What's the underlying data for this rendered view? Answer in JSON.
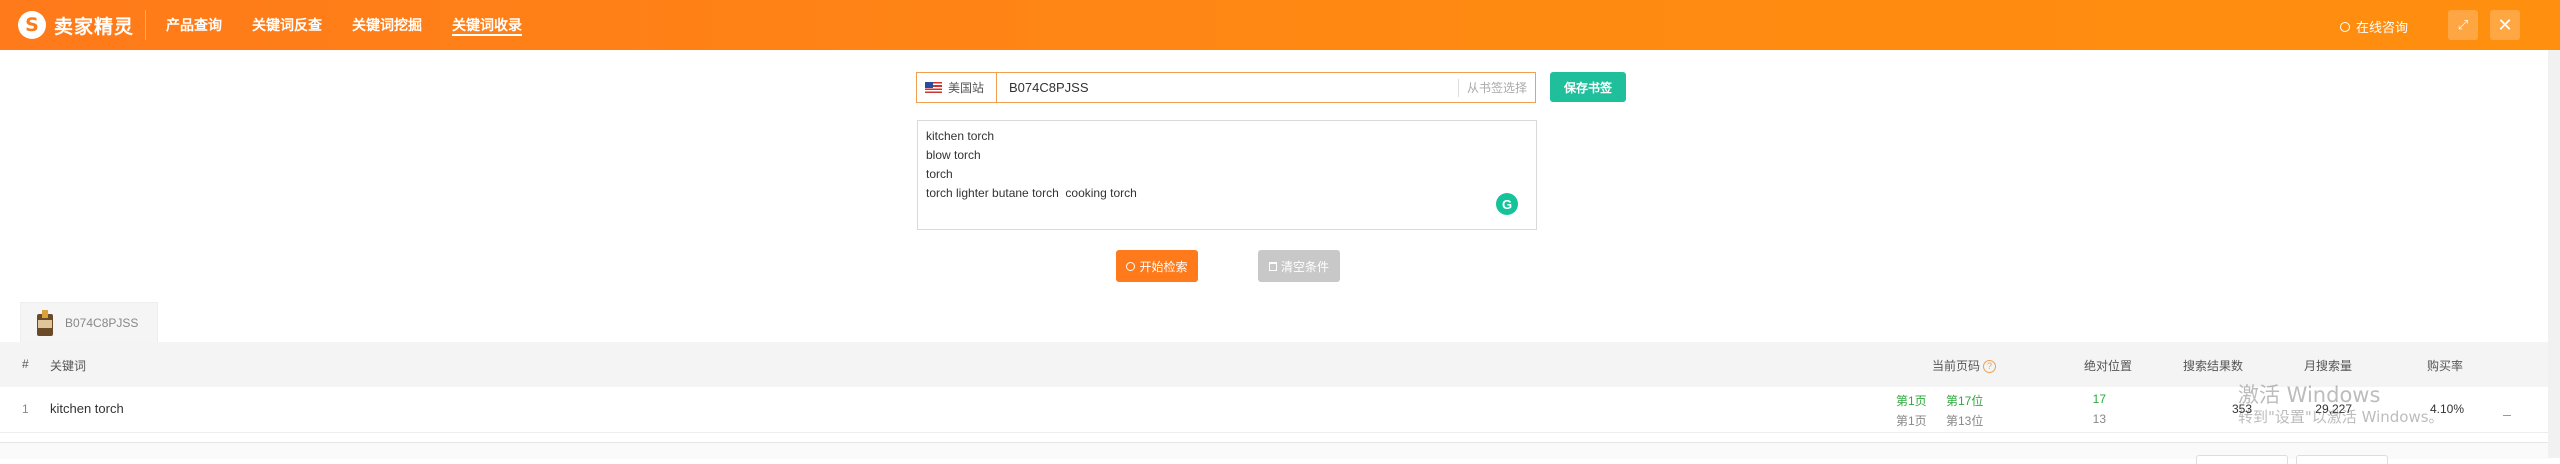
{
  "app": {
    "logo_mark": "S",
    "logo_text": "卖家精灵"
  },
  "nav": {
    "items": [
      {
        "label": "产品查询",
        "active": false
      },
      {
        "label": "关键词反查",
        "active": false
      },
      {
        "label": "关键词挖掘",
        "active": false
      },
      {
        "label": "关键词收录",
        "active": true
      }
    ]
  },
  "header_right": {
    "consult_label": "在线咨询",
    "expand_icon": "expand-icon",
    "close_icon": "close-icon"
  },
  "search": {
    "site_label": "美国站",
    "asin_value": "B074C8PJSS",
    "bookmark_select_label": "从书签选择",
    "save_button": "保存书签"
  },
  "keywords": {
    "lines": [
      "kitchen torch",
      "blow torch",
      "torch",
      "torch lighter butane torch  cooking torch"
    ]
  },
  "actions": {
    "search_button": "开始检索",
    "clear_button": "清空条件"
  },
  "product_tab": {
    "asin": "B074C8PJSS"
  },
  "table": {
    "headers": {
      "index": "#",
      "keyword": "关键词",
      "current_page": "当前页码",
      "absolute_position": "绝对位置",
      "search_results": "搜索结果数",
      "monthly_searches": "月搜索量",
      "purchase_rate": "购买率"
    },
    "rows": [
      {
        "index": "1",
        "keyword": "kitchen torch",
        "page_a": "第1页",
        "pos_a": "第17位",
        "abs_a": "17",
        "page_b": "第1页",
        "pos_b": "第13位",
        "abs_b": "13",
        "search_results": "353",
        "monthly_searches": "29,227",
        "purchase_rate": "4.10%"
      }
    ]
  },
  "watermark": {
    "line1": "激活 Windows",
    "line2": "转到\"设置\"以激活 Windows。"
  },
  "colors": {
    "brand_orange": "#ff7a1a",
    "save_green": "#1fbf9c",
    "rank_green": "#2eaa3e"
  }
}
